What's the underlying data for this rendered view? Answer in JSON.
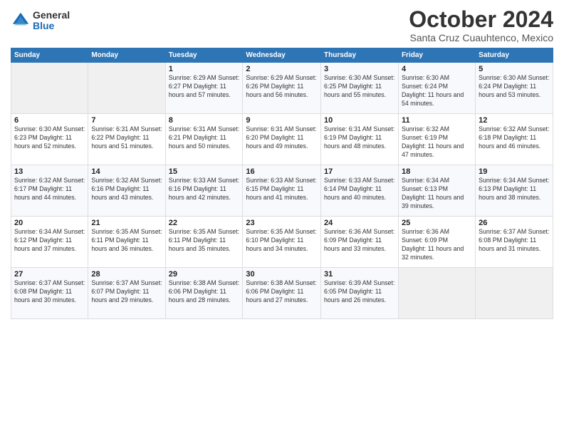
{
  "logo": {
    "general": "General",
    "blue": "Blue"
  },
  "title": "October 2024",
  "location": "Santa Cruz Cuauhtenco, Mexico",
  "days_of_week": [
    "Sunday",
    "Monday",
    "Tuesday",
    "Wednesday",
    "Thursday",
    "Friday",
    "Saturday"
  ],
  "weeks": [
    [
      {
        "day": "",
        "detail": ""
      },
      {
        "day": "",
        "detail": ""
      },
      {
        "day": "1",
        "detail": "Sunrise: 6:29 AM\nSunset: 6:27 PM\nDaylight: 11 hours and 57 minutes."
      },
      {
        "day": "2",
        "detail": "Sunrise: 6:29 AM\nSunset: 6:26 PM\nDaylight: 11 hours and 56 minutes."
      },
      {
        "day": "3",
        "detail": "Sunrise: 6:30 AM\nSunset: 6:25 PM\nDaylight: 11 hours and 55 minutes."
      },
      {
        "day": "4",
        "detail": "Sunrise: 6:30 AM\nSunset: 6:24 PM\nDaylight: 11 hours and 54 minutes."
      },
      {
        "day": "5",
        "detail": "Sunrise: 6:30 AM\nSunset: 6:24 PM\nDaylight: 11 hours and 53 minutes."
      }
    ],
    [
      {
        "day": "6",
        "detail": "Sunrise: 6:30 AM\nSunset: 6:23 PM\nDaylight: 11 hours and 52 minutes."
      },
      {
        "day": "7",
        "detail": "Sunrise: 6:31 AM\nSunset: 6:22 PM\nDaylight: 11 hours and 51 minutes."
      },
      {
        "day": "8",
        "detail": "Sunrise: 6:31 AM\nSunset: 6:21 PM\nDaylight: 11 hours and 50 minutes."
      },
      {
        "day": "9",
        "detail": "Sunrise: 6:31 AM\nSunset: 6:20 PM\nDaylight: 11 hours and 49 minutes."
      },
      {
        "day": "10",
        "detail": "Sunrise: 6:31 AM\nSunset: 6:19 PM\nDaylight: 11 hours and 48 minutes."
      },
      {
        "day": "11",
        "detail": "Sunrise: 6:32 AM\nSunset: 6:19 PM\nDaylight: 11 hours and 47 minutes."
      },
      {
        "day": "12",
        "detail": "Sunrise: 6:32 AM\nSunset: 6:18 PM\nDaylight: 11 hours and 46 minutes."
      }
    ],
    [
      {
        "day": "13",
        "detail": "Sunrise: 6:32 AM\nSunset: 6:17 PM\nDaylight: 11 hours and 44 minutes."
      },
      {
        "day": "14",
        "detail": "Sunrise: 6:32 AM\nSunset: 6:16 PM\nDaylight: 11 hours and 43 minutes."
      },
      {
        "day": "15",
        "detail": "Sunrise: 6:33 AM\nSunset: 6:16 PM\nDaylight: 11 hours and 42 minutes."
      },
      {
        "day": "16",
        "detail": "Sunrise: 6:33 AM\nSunset: 6:15 PM\nDaylight: 11 hours and 41 minutes."
      },
      {
        "day": "17",
        "detail": "Sunrise: 6:33 AM\nSunset: 6:14 PM\nDaylight: 11 hours and 40 minutes."
      },
      {
        "day": "18",
        "detail": "Sunrise: 6:34 AM\nSunset: 6:13 PM\nDaylight: 11 hours and 39 minutes."
      },
      {
        "day": "19",
        "detail": "Sunrise: 6:34 AM\nSunset: 6:13 PM\nDaylight: 11 hours and 38 minutes."
      }
    ],
    [
      {
        "day": "20",
        "detail": "Sunrise: 6:34 AM\nSunset: 6:12 PM\nDaylight: 11 hours and 37 minutes."
      },
      {
        "day": "21",
        "detail": "Sunrise: 6:35 AM\nSunset: 6:11 PM\nDaylight: 11 hours and 36 minutes."
      },
      {
        "day": "22",
        "detail": "Sunrise: 6:35 AM\nSunset: 6:11 PM\nDaylight: 11 hours and 35 minutes."
      },
      {
        "day": "23",
        "detail": "Sunrise: 6:35 AM\nSunset: 6:10 PM\nDaylight: 11 hours and 34 minutes."
      },
      {
        "day": "24",
        "detail": "Sunrise: 6:36 AM\nSunset: 6:09 PM\nDaylight: 11 hours and 33 minutes."
      },
      {
        "day": "25",
        "detail": "Sunrise: 6:36 AM\nSunset: 6:09 PM\nDaylight: 11 hours and 32 minutes."
      },
      {
        "day": "26",
        "detail": "Sunrise: 6:37 AM\nSunset: 6:08 PM\nDaylight: 11 hours and 31 minutes."
      }
    ],
    [
      {
        "day": "27",
        "detail": "Sunrise: 6:37 AM\nSunset: 6:08 PM\nDaylight: 11 hours and 30 minutes."
      },
      {
        "day": "28",
        "detail": "Sunrise: 6:37 AM\nSunset: 6:07 PM\nDaylight: 11 hours and 29 minutes."
      },
      {
        "day": "29",
        "detail": "Sunrise: 6:38 AM\nSunset: 6:06 PM\nDaylight: 11 hours and 28 minutes."
      },
      {
        "day": "30",
        "detail": "Sunrise: 6:38 AM\nSunset: 6:06 PM\nDaylight: 11 hours and 27 minutes."
      },
      {
        "day": "31",
        "detail": "Sunrise: 6:39 AM\nSunset: 6:05 PM\nDaylight: 11 hours and 26 minutes."
      },
      {
        "day": "",
        "detail": ""
      },
      {
        "day": "",
        "detail": ""
      }
    ]
  ]
}
